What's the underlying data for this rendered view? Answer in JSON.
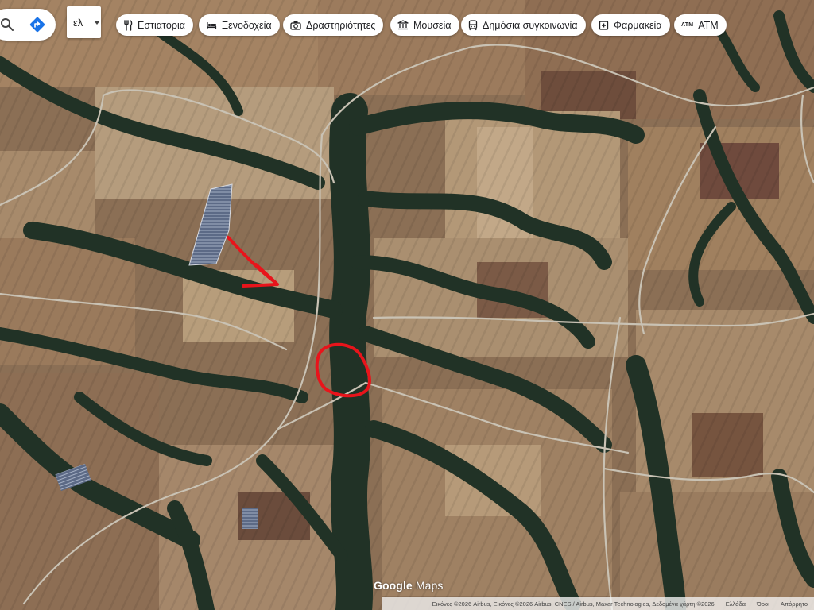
{
  "map": {
    "map_type": "satellite",
    "language_selector": {
      "value": "ελ"
    },
    "categories": [
      {
        "label": "Εστιατόρια",
        "icon": "restaurant-icon"
      },
      {
        "label": "Ξενοδοχεία",
        "icon": "hotel-icon"
      },
      {
        "label": "Δραστηριότητες",
        "icon": "camera-icon"
      },
      {
        "label": "Μουσεία",
        "icon": "museum-icon"
      },
      {
        "label": "Δημόσια συγκοινωνία",
        "icon": "transit-icon"
      },
      {
        "label": "Φαρμακεία",
        "icon": "pharmacy-icon"
      },
      {
        "label": "ATM",
        "icon": "atm-icon",
        "icon_text": "ATM"
      }
    ],
    "annotations": {
      "color": "#e8141b",
      "items": [
        {
          "type": "arrow",
          "label": "red arrow drawn on map"
        },
        {
          "type": "circle",
          "label": "red circled area on map"
        }
      ]
    },
    "logo": {
      "brand": "Google",
      "product": "Maps"
    },
    "attribution": {
      "imagery": "Εικόνες ©2026 Airbus, Εικόνες ©2026 Airbus, CNES / Airbus, Maxar Technologies, Δεδομένα χάρτη ©2026",
      "country": "Ελλάδα",
      "terms": "Όροι",
      "privacy": "Απόρρητο"
    },
    "colors": {
      "field_light": "#b49a78",
      "field_mid": "#98795a",
      "field_dark": "#6b4c3c",
      "forest": "#213226",
      "road": "#c9c2b4",
      "accent_blue": "#1a73e8"
    }
  }
}
